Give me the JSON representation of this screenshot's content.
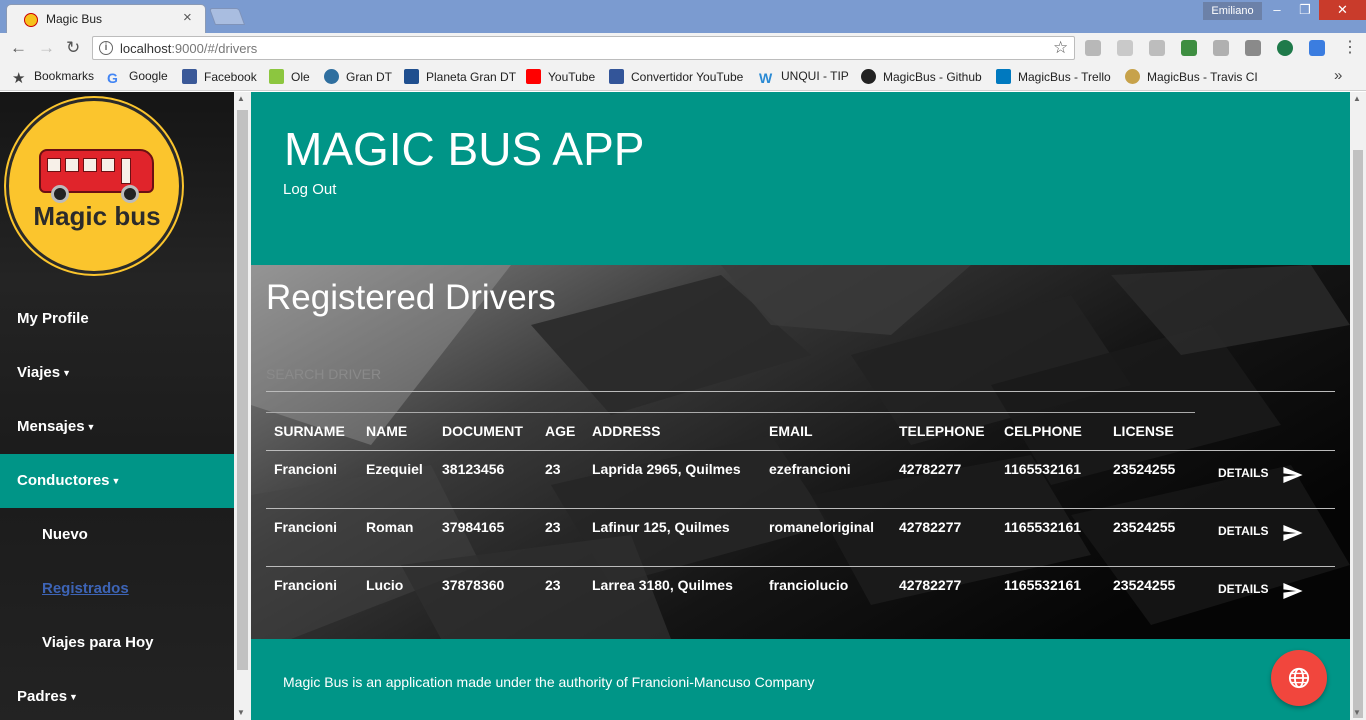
{
  "browser": {
    "tab_title": "Magic Bus",
    "user": "Emiliano",
    "url_host": "localhost",
    "url_rest": ":9000/#/drivers",
    "bookmarks": [
      {
        "label": "Bookmarks",
        "icon": "star-icon",
        "color": "#444444"
      },
      {
        "label": "Google",
        "icon": "google-icon",
        "color": "#4285f4"
      },
      {
        "label": "Facebook",
        "icon": "facebook-icon",
        "color": "#3b5998"
      },
      {
        "label": "Ole",
        "icon": "ole-icon",
        "color": "#8cc63f"
      },
      {
        "label": "Gran DT",
        "icon": "globe-icon",
        "color": "#2f6f9f"
      },
      {
        "label": "Planeta Gran DT",
        "icon": "grandt-icon",
        "color": "#1f4f8f"
      },
      {
        "label": "YouTube",
        "icon": "youtube-icon",
        "color": "#ff0000"
      },
      {
        "label": "Convertidor YouTube",
        "icon": "mp3-icon",
        "color": "#335599"
      },
      {
        "label": "UNQUI - TIP",
        "icon": "w-icon",
        "color": "#2a8ad4"
      },
      {
        "label": "MagicBus - Github",
        "icon": "github-icon",
        "color": "#222222"
      },
      {
        "label": "MagicBus - Trello",
        "icon": "trello-icon",
        "color": "#0079bf"
      },
      {
        "label": "MagicBus - Travis CI",
        "icon": "travis-icon",
        "color": "#c7a24a"
      }
    ]
  },
  "sidebar": {
    "logo_text": "Magic bus",
    "items": [
      {
        "label": "My Profile",
        "caret": false
      },
      {
        "label": "Viajes",
        "caret": true
      },
      {
        "label": "Mensajes",
        "caret": true
      },
      {
        "label": "Conductores",
        "caret": true
      },
      {
        "label": "Nuevo",
        "caret": false
      },
      {
        "label": "Registrados",
        "caret": false
      },
      {
        "label": "Viajes para Hoy",
        "caret": false
      },
      {
        "label": "Padres",
        "caret": true
      }
    ]
  },
  "header": {
    "title": "MAGIC BUS APP",
    "logout": "Log Out"
  },
  "main": {
    "title": "Registered Drivers",
    "search_placeholder": "SEARCH DRIVER",
    "columns": [
      "SURNAME",
      "NAME",
      "DOCUMENT",
      "AGE",
      "ADDRESS",
      "EMAIL",
      "TELEPHONE",
      "CELPHONE",
      "LICENSE"
    ],
    "rows": [
      {
        "surname": "Francioni",
        "name": "Ezequiel",
        "document": "38123456",
        "age": "23",
        "address": "Laprida 2965, Quilmes",
        "email": "ezefrancioni",
        "telephone": "42782277",
        "celphone": "1165532161",
        "license": "23524255"
      },
      {
        "surname": "Francioni",
        "name": "Roman",
        "document": "37984165",
        "age": "23",
        "address": "Lafinur 125, Quilmes",
        "email": "romaneloriginal",
        "telephone": "42782277",
        "celphone": "1165532161",
        "license": "23524255"
      },
      {
        "surname": "Francioni",
        "name": "Lucio",
        "document": "37878360",
        "age": "23",
        "address": "Larrea 3180, Quilmes",
        "email": "franciolucio",
        "telephone": "42782277",
        "celphone": "1165532161",
        "license": "23524255"
      }
    ],
    "details_label": "DETAILS"
  },
  "footer": {
    "text": "Magic Bus is an application made under the authority of Francioni-Mancuso Company"
  },
  "colors": {
    "teal": "#009587",
    "fab": "#f1463d",
    "link": "#3d64b6"
  }
}
